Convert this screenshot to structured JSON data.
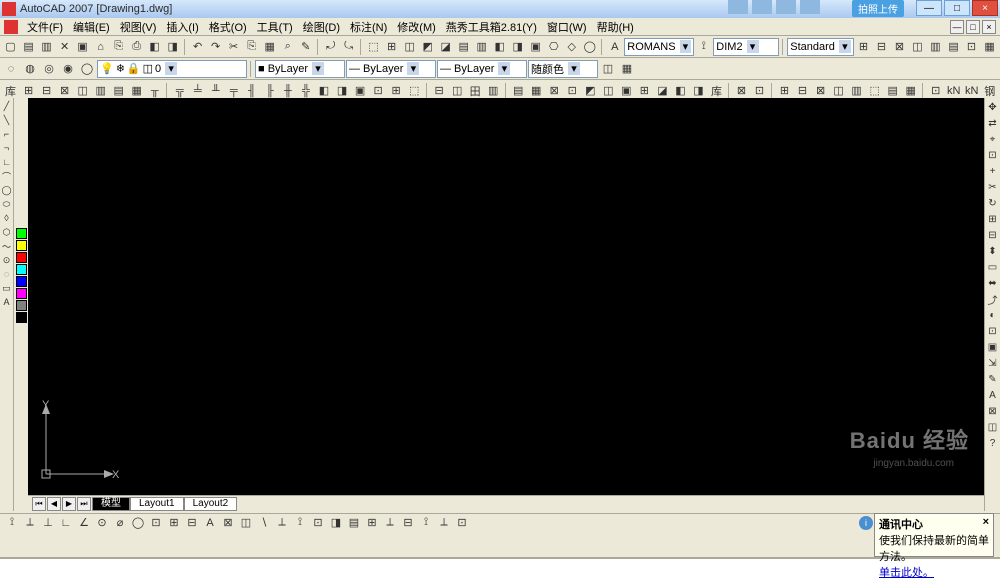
{
  "title": "AutoCAD 2007   [Drawing1.dwg]",
  "upload_label": "拍照上传",
  "menus": [
    "文件(F)",
    "编辑(E)",
    "视图(V)",
    "插入(I)",
    "格式(O)",
    "工具(T)",
    "绘图(D)",
    "标注(N)",
    "修改(M)",
    "燕秀工具箱2.81(Y)",
    "窗口(W)",
    "帮助(H)"
  ],
  "toolbar1": {
    "file_glyphs": [
      "▢",
      "▤",
      "▥",
      "✕",
      "▣",
      "⌂",
      "⎘",
      "⎙",
      "◧",
      "◨"
    ],
    "edit_glyphs": [
      "↶",
      "↷",
      "✂",
      "⎘",
      "▦",
      "⌕",
      "✎"
    ],
    "zoom_glyphs": [
      "⤾",
      "⤿"
    ],
    "more_glyphs": [
      "⬚",
      "⊞",
      "◫",
      "◩",
      "◪",
      "▤",
      "▥",
      "◧",
      "◨",
      "▣",
      "⎔",
      "◇",
      "◯"
    ],
    "textstyle": "A",
    "textstyle_sel": "ROMANS",
    "dimstyle_glyph": "⟟",
    "dimstyle_sel": "DIM2",
    "standard_sel": "Standard",
    "table_glyphs": [
      "⊞",
      "⊟",
      "⊠",
      "◫",
      "▥",
      "▤",
      "⊡",
      "▦"
    ]
  },
  "toolbar2": {
    "layer_glyphs": [
      "◌",
      "◍",
      "◎",
      "◉",
      "◯"
    ],
    "layer_state": "0",
    "layer_props": [
      "💡",
      "❄",
      "🔒",
      "◫"
    ],
    "layer_sel": "ByLayer",
    "linetype_sel": "ByLayer",
    "lineweight_sel": "ByLayer",
    "color_sel": "随颜色",
    "end_glyphs": [
      "◫",
      "▦"
    ]
  },
  "toolbar3": {
    "glyphs": [
      "库",
      "⊞",
      "⊟",
      "⊠",
      "◫",
      "▥",
      "▤",
      "▦",
      "╥",
      "╦",
      "╧",
      "╨",
      "╤",
      "╢",
      "╟",
      "╫",
      "╬",
      "◧",
      "◨",
      "▣",
      "⊡",
      "⊞",
      "⬚",
      "⊟",
      "◫",
      "田",
      "▥",
      "▤",
      "▦",
      "⊠",
      "⊡",
      "◩",
      "◫",
      "▣",
      "⊞",
      "◪",
      "◧",
      "◨",
      "库",
      "⊠",
      "⊡",
      "⊞",
      "⊟",
      "⊠",
      "◫",
      "▥",
      "⬚",
      "▤",
      "▦",
      "⊡",
      "kN",
      "kN",
      "钢"
    ]
  },
  "left_tools": [
    "╱",
    "╲",
    "⌐",
    "¬",
    "∟",
    "⌒",
    "◯",
    "⬭",
    "◊",
    "⬡",
    "～",
    "⊙",
    "◌",
    "▭",
    "A"
  ],
  "right_tools": [
    "✥",
    "⇄",
    "⌖",
    "⊡",
    "+",
    "✂",
    "↻",
    "⊞",
    "⊟",
    "⬍",
    "▭",
    "⬌",
    "⤴",
    "◐",
    "⊡",
    "▣",
    "⇲",
    "✎",
    "A",
    "⊠",
    "◫",
    "?"
  ],
  "dim_tools": [
    "⟟",
    "⟂",
    "⊥",
    "∟",
    "∠",
    "⊙",
    "⌀",
    "◯",
    "⊡",
    "⊞",
    "⊟",
    "A",
    "⊠",
    "◫",
    "∖",
    "⟂",
    "⟟",
    "⊡",
    "◨",
    "▤",
    "⊞",
    "⟂",
    "⊟",
    "⟟",
    "⟂",
    "⊡"
  ],
  "palette_colors": [
    "#00ff00",
    "#ffff00",
    "#ff0000",
    "#00ffff",
    "#0000ff",
    "#ff00ff",
    "#808080",
    "#000000"
  ],
  "tabs": {
    "nav": [
      "⏮",
      "◀",
      "▶",
      "⏭"
    ],
    "items": [
      "模型",
      "Layout1",
      "Layout2"
    ],
    "active": 0
  },
  "ucs": {
    "x": "X",
    "y": "Y"
  },
  "comm": {
    "title": "通讯中心",
    "body": "使我们保持最新的简单方法。",
    "link": "单击此处。",
    "close": "×",
    "icon": "i"
  },
  "command_value": "",
  "window_buttons": {
    "min": "—",
    "max": "□",
    "close": "×"
  },
  "doc_buttons": [
    "—",
    "□",
    "×"
  ],
  "watermark": "Baidu 经验",
  "watermark2": "jingyan.baidu.com"
}
